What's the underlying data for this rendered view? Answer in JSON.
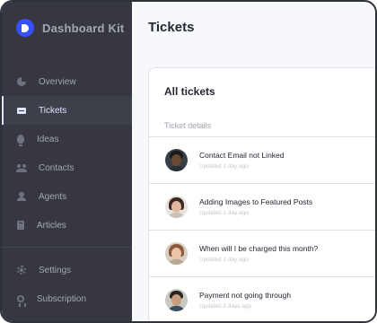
{
  "app": {
    "name": "Dashboard Kit",
    "brand_color": "#3751ff"
  },
  "sidebar": {
    "items": [
      {
        "label": "Overview",
        "icon": "pie-chart-icon",
        "active": false
      },
      {
        "label": "Tickets",
        "icon": "ticket-icon",
        "active": true
      },
      {
        "label": "Ideas",
        "icon": "lightbulb-icon",
        "active": false
      },
      {
        "label": "Contacts",
        "icon": "people-icon",
        "active": false
      },
      {
        "label": "Agents",
        "icon": "user-icon",
        "active": false
      },
      {
        "label": "Articles",
        "icon": "book-icon",
        "active": false
      }
    ],
    "footer_items": [
      {
        "label": "Settings",
        "icon": "gear-icon"
      },
      {
        "label": "Subscription",
        "icon": "badge-icon"
      }
    ]
  },
  "main": {
    "page_title": "Tickets",
    "card_title": "All tickets",
    "column_header": "Ticket details",
    "tickets": [
      {
        "title": "Contact Email not Linked",
        "updated": "Updated 1 day ago"
      },
      {
        "title": "Adding Images to Featured Posts",
        "updated": "Updated 1 day ago"
      },
      {
        "title": "When will I be charged this month?",
        "updated": "Updated 1 day ago"
      },
      {
        "title": "Payment not going through",
        "updated": "Updated 2 days ago"
      }
    ]
  }
}
